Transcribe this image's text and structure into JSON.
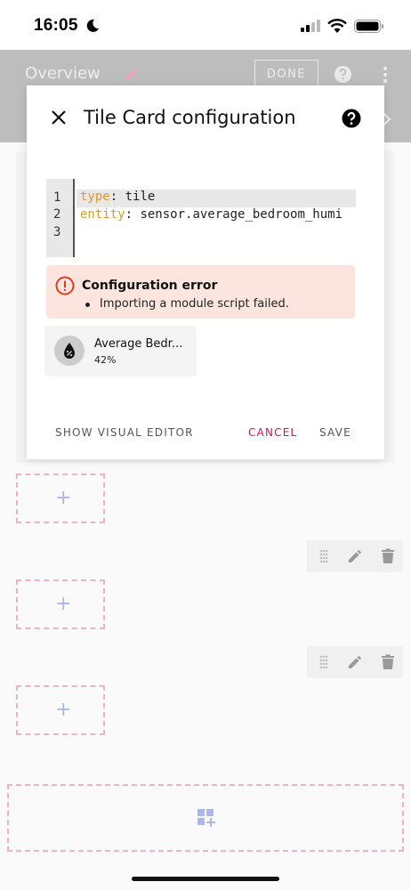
{
  "status_bar": {
    "time": "16:05"
  },
  "toolbar": {
    "title": "Overview",
    "done_label": "DONE"
  },
  "dialog": {
    "title": "Tile Card configuration",
    "yaml": {
      "line_numbers": [
        "1",
        "2",
        "3"
      ],
      "lines": [
        {
          "key": "type",
          "value": " tile"
        },
        {
          "key": "entity",
          "value": " sensor.average_bedroom_humi"
        },
        {
          "key": "",
          "value": ""
        }
      ]
    },
    "error": {
      "title": "Configuration error",
      "message": "Importing a module script failed."
    },
    "preview_tile": {
      "name": "Average Bedr...",
      "state": "42%"
    },
    "buttons": {
      "visual_editor": "SHOW VISUAL EDITOR",
      "cancel": "CANCEL",
      "save": "SAVE"
    }
  },
  "colors": {
    "accent": "#d6105a",
    "placeholder_border": "#eeb2c8",
    "plus": "#a9b8e6",
    "error_bg": "#fce5de"
  },
  "icons": [
    "moon-icon",
    "signal-icon",
    "wifi-icon",
    "battery-icon",
    "pencil-icon",
    "help-icon",
    "more-vert-icon",
    "close-icon",
    "alert-circle-icon",
    "water-percent-icon",
    "drag-handle-icon",
    "delete-icon",
    "plus-icon",
    "add-section-icon"
  ]
}
